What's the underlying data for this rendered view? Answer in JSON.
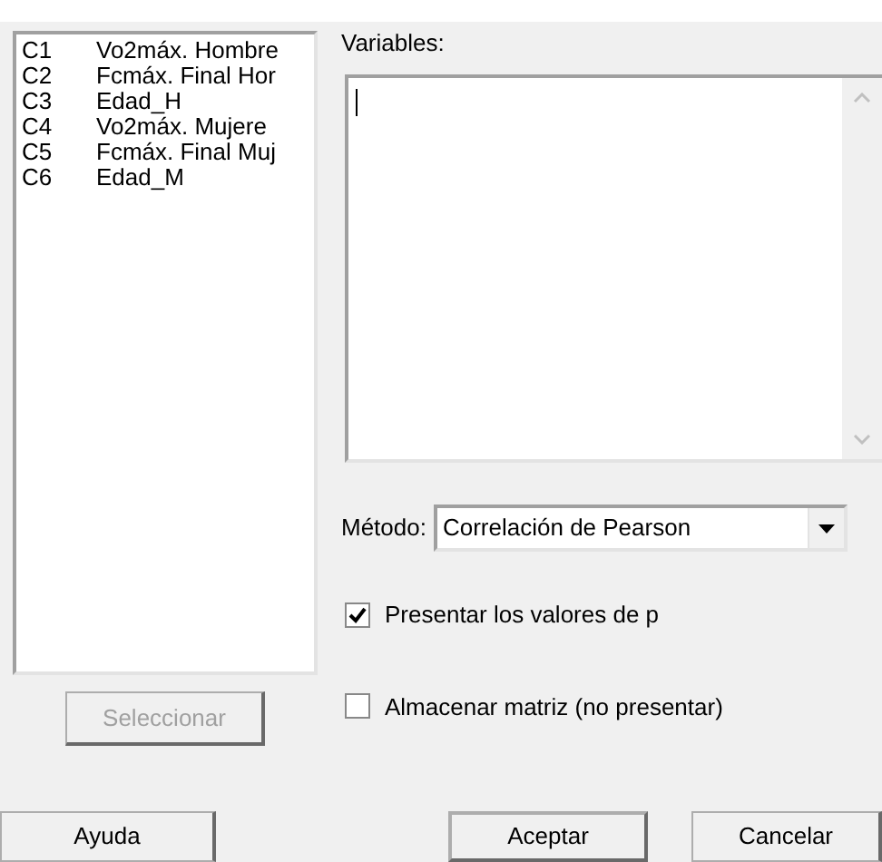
{
  "variable_list": [
    {
      "column": "C1",
      "name": "Vo2máx. Hombre"
    },
    {
      "column": "C2",
      "name": "Fcmáx. Final Hor"
    },
    {
      "column": "C3",
      "name": "Edad_H"
    },
    {
      "column": "C4",
      "name": "Vo2máx. Mujere"
    },
    {
      "column": "C5",
      "name": "Fcmáx. Final Muj"
    },
    {
      "column": "C6",
      "name": "Edad_M"
    }
  ],
  "variables": {
    "label": "Variables:"
  },
  "method": {
    "label": "Método:",
    "value": "Correlación de Pearson"
  },
  "options": [
    {
      "label": "Presentar los valores de p",
      "checked": true
    },
    {
      "label": "Almacenar matriz (no presentar)",
      "checked": false
    }
  ],
  "select_button": {
    "label": "Seleccionar",
    "disabled": true
  },
  "buttons": [
    {
      "label": "Ayuda",
      "default": false
    },
    {
      "label": "Aceptar",
      "default": true
    },
    {
      "label": "Cancelar",
      "default": false
    }
  ]
}
